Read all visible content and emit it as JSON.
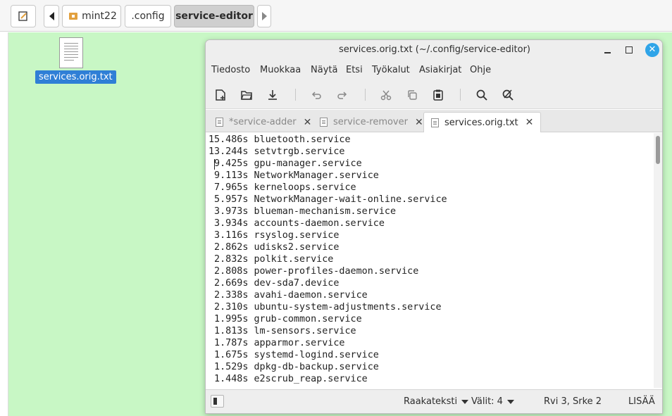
{
  "file_manager": {
    "breadcrumbs": [
      {
        "label": "mint22"
      },
      {
        "label": ".config"
      },
      {
        "label": "service-editor"
      }
    ],
    "desktop_file": {
      "name": "services.orig.txt"
    }
  },
  "editor": {
    "window_title": "services.orig.txt (~/.config/service-editor)",
    "menu": [
      "Tiedosto",
      "Muokkaa",
      "Näytä",
      "Etsi",
      "Työkalut",
      "Asiakirjat",
      "Ohje"
    ],
    "tabs": [
      {
        "label": "*service-adder",
        "active": false
      },
      {
        "label": "service-remover",
        "active": false
      },
      {
        "label": "services.orig.txt",
        "active": true
      }
    ],
    "lines": [
      "15.486s bluetooth.service",
      "13.244s setvtrgb.service",
      " 9.425s gpu-manager.service",
      " 9.113s NetworkManager.service",
      " 7.965s kerneloops.service",
      " 5.957s NetworkManager-wait-online.service",
      " 3.973s blueman-mechanism.service",
      " 3.934s accounts-daemon.service",
      " 3.116s rsyslog.service",
      " 2.862s udisks2.service",
      " 2.832s polkit.service",
      " 2.808s power-profiles-daemon.service",
      " 2.669s dev-sda7.device",
      " 2.338s avahi-daemon.service",
      " 2.310s ubuntu-system-adjustments.service",
      " 1.995s grub-common.service",
      " 1.813s lm-sensors.service",
      " 1.787s apparmor.service",
      " 1.675s systemd-logind.service",
      " 1.529s dpkg-db-backup.service",
      " 1.448s e2scrub_reap.service"
    ],
    "status": {
      "language": "Raakateksti",
      "tab_width": "Välit: 4",
      "position": "Rvi 3, Srke 2",
      "mode": "LISÄÄ"
    }
  },
  "icons": {
    "toolbar": [
      "new-document-icon",
      "open-icon",
      "save-icon",
      "undo-icon",
      "redo-icon",
      "cut-icon",
      "copy-icon",
      "paste-icon",
      "search-icon",
      "search-replace-icon"
    ]
  },
  "colors": {
    "desktop_bg": "#c8f7c5",
    "selection_blue": "#2f7fd6",
    "close_button": "#2fa4e8"
  }
}
